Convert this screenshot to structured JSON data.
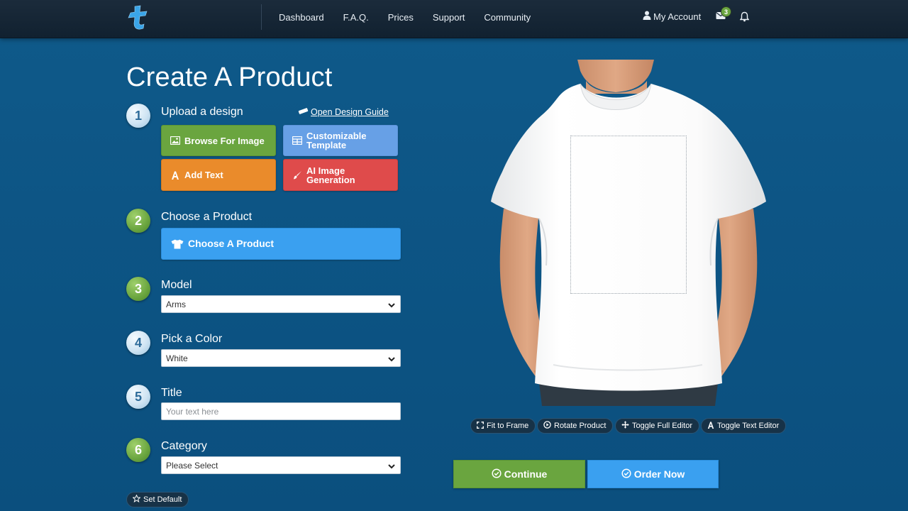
{
  "nav": {
    "links": [
      "Dashboard",
      "F.A.Q.",
      "Prices",
      "Support",
      "Community"
    ],
    "account": "My Account",
    "mail_count": "3"
  },
  "page_title": "Create A Product",
  "steps": {
    "s1": {
      "num": "1",
      "label": "Upload a design",
      "guide_link": "Open Design Guide"
    },
    "s2": {
      "num": "2",
      "label": "Choose a Product",
      "button": "Choose A Product"
    },
    "s3": {
      "num": "3",
      "label": "Model",
      "value": "Arms"
    },
    "s4": {
      "num": "4",
      "label": "Pick a Color",
      "value": "White"
    },
    "s5": {
      "num": "5",
      "label": "Title",
      "placeholder": "Your text here"
    },
    "s6": {
      "num": "6",
      "label": "Category",
      "value": "Please Select"
    }
  },
  "upload_tiles": {
    "browse": "Browse For Image",
    "template_l1": "Customizable",
    "template_l2": "Template",
    "text": "Add Text",
    "ai_l1": "AI Image",
    "ai_l2": "Generation"
  },
  "set_default": "Set Default",
  "editor_tools": {
    "fit": "Fit to Frame",
    "rotate": "Rotate Product",
    "full": "Toggle Full Editor",
    "text": "Toggle Text Editor"
  },
  "actions": {
    "continue": "Continue",
    "order": "Order Now"
  },
  "colors": {
    "green": "#6aa53f",
    "blue": "#3aa0f0",
    "orange": "#ea8b2b",
    "red": "#df4b4b",
    "light_blue": "#67a0e6",
    "background": "#0f5a8a",
    "topbar": "#1b2b3b"
  },
  "icons": {
    "logo": "t-logo",
    "account": "user-icon",
    "mail": "envelope-icon",
    "bell": "bell-icon"
  }
}
